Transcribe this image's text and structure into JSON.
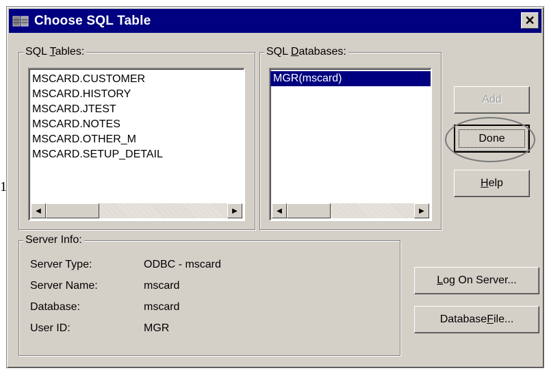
{
  "stray_text": "1",
  "window": {
    "title": "Choose SQL Table",
    "close_glyph": "✕"
  },
  "sql_tables": {
    "label_pre": "SQL ",
    "label_accel": "T",
    "label_post": "ables:",
    "items": [
      "MSCARD.CUSTOMER",
      "MSCARD.HISTORY",
      "MSCARD.JTEST",
      "MSCARD.NOTES",
      "MSCARD.OTHER_M",
      "MSCARD.SETUP_DETAIL"
    ]
  },
  "sql_databases": {
    "label_pre": "SQL ",
    "label_accel": "D",
    "label_post": "atabases:",
    "items": [
      "MGR(mscard)"
    ],
    "selected_index": 0
  },
  "buttons": {
    "add": "Add",
    "done": "Done",
    "help_accel": "H",
    "help_rest": "elp",
    "logon_accel": "L",
    "logon_rest": "og On Server...",
    "dbfile_pre": "Database ",
    "dbfile_accel": "F",
    "dbfile_post": "ile..."
  },
  "server_info": {
    "label": "Server Info:",
    "rows": [
      {
        "key": "Server Type:",
        "value": "ODBC - mscard"
      },
      {
        "key": "Server Name:",
        "value": "mscard"
      },
      {
        "key": "Database:",
        "value": "mscard"
      },
      {
        "key": "User ID:",
        "value": "MGR"
      }
    ]
  },
  "colors": {
    "titlebar": "#000080",
    "face": "#d4d0c8",
    "selection": "#000080"
  }
}
